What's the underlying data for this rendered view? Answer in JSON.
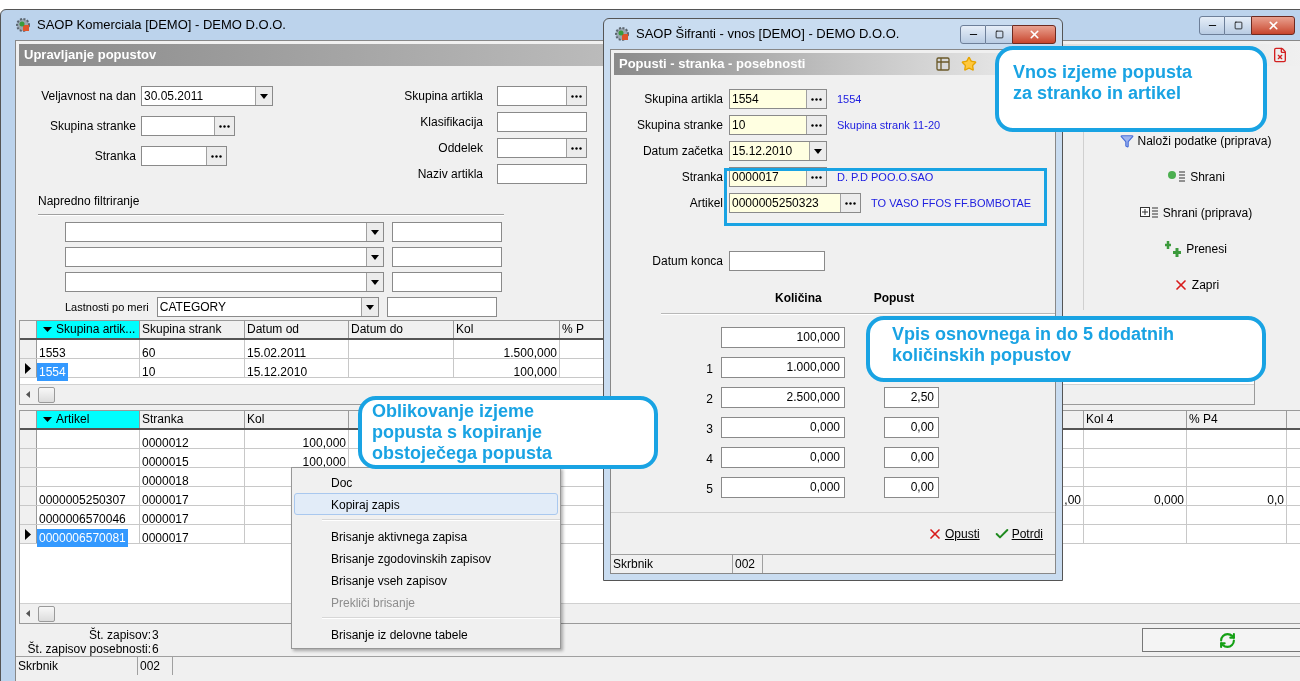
{
  "main_window": {
    "title": "SAOP Komerciala [DEMO] - DEMO D.O.O.",
    "panel_title": "Upravljanje popustov"
  },
  "filters": {
    "left": [
      {
        "label": "Veljavnost na dan",
        "kind": "date",
        "value": "30.05.2011"
      },
      {
        "label": "Skupina stranke",
        "kind": "lookup"
      },
      {
        "label": "Stranka",
        "kind": "lookup"
      }
    ],
    "right": [
      {
        "label": "Skupina artikla",
        "kind": "lookup"
      },
      {
        "label": "Klasifikacija",
        "kind": "text"
      },
      {
        "label": "Oddelek",
        "kind": "lookup"
      },
      {
        "label": "Naziv artikla",
        "kind": "text"
      }
    ],
    "advanced_title": "Napredno filtriranje",
    "advanced_rows": [
      {
        "kind": "combo"
      },
      {
        "kind": "combo"
      },
      {
        "kind": "combo"
      },
      {
        "kind": "custom",
        "label": "Lastnosti po meri",
        "value": "CATEGORY"
      }
    ]
  },
  "toolbar": [
    {
      "kind": "load",
      "label": "Naloži podatke (priprava)"
    },
    {
      "kind": "save",
      "label": "Shrani"
    },
    {
      "kind": "draft",
      "label": "Shrani (priprava)"
    },
    {
      "kind": "transfer",
      "label": "Prenesi"
    },
    {
      "kind": "close",
      "label": "Zapri"
    }
  ],
  "upper_table": {
    "columns": [
      {
        "label": "Skupina artik...",
        "sorted": true
      },
      {
        "label": "Skupina strank",
        "sorted": false
      },
      {
        "label": "Datum od",
        "sorted": false
      },
      {
        "label": "Datum do",
        "sorted": false
      },
      {
        "label": "Kol",
        "sorted": false
      },
      {
        "label": "% P",
        "sorted": false
      }
    ],
    "rows": [
      {
        "selected": false,
        "cells": {
          "skupina_artikla": "1553",
          "skupina_strank": "60",
          "datum_od": "15.02.2011",
          "kol": "1.500,000"
        }
      },
      {
        "selected": true,
        "cells": {
          "skupina_artikla": "1554",
          "skupina_strank": "10",
          "datum_od": "15.12.2010",
          "kol": "100,000"
        }
      }
    ]
  },
  "lower_table": {
    "columns": [
      {
        "label": "Artikel",
        "sorted": true
      },
      {
        "label": "Stranka",
        "sorted": false
      },
      {
        "label": "Kol",
        "sorted": false
      },
      {
        "sorted": false
      },
      {
        "label": "Kol 4",
        "sorted": false
      },
      {
        "label": "% P4",
        "sorted": false
      }
    ],
    "rows": [
      {
        "selected": false,
        "cells": {
          "stranka": "0000012",
          "kol": "100,000"
        }
      },
      {
        "selected": false,
        "cells": {
          "stranka": "0000015",
          "kol": "100,000"
        }
      },
      {
        "selected": false,
        "cells": {
          "stranka": "0000018"
        }
      },
      {
        "selected": false,
        "cells": {
          "artikel": "0000005250307",
          "stranka": "0000017",
          "column_4": ",00",
          "kol_4": "0,000",
          "p4": "0,0"
        }
      },
      {
        "selected": false,
        "cells": {
          "artikel": "0000006570046",
          "stranka": "0000017"
        }
      },
      {
        "selected": true,
        "cells": {
          "artikel": "0000006570081",
          "stranka": "0000017"
        }
      }
    ]
  },
  "status": {
    "records_label": "Št. zapisov:",
    "records": "3",
    "special_label": "Št. zapisov posebnosti:",
    "special": "6"
  },
  "status_bar": {
    "label": "Skrbnik",
    "value": "002"
  },
  "context_menu": [
    {
      "kind": "item",
      "label": "Doc",
      "selected": false,
      "disabled": false
    },
    {
      "kind": "item",
      "label": "Kopiraj zapis",
      "selected": true,
      "disabled": false
    },
    {
      "kind": "separator"
    },
    {
      "kind": "item",
      "label": "Brisanje aktivnega zapisa",
      "selected": false,
      "disabled": false
    },
    {
      "kind": "item",
      "label": "Brisanje zgodovinskih zapisov",
      "selected": false,
      "disabled": false
    },
    {
      "kind": "item",
      "label": "Brisanje vseh zapisov",
      "selected": false,
      "disabled": false
    },
    {
      "kind": "item",
      "label": "Prekliči brisanje",
      "selected": false,
      "disabled": true
    },
    {
      "kind": "separator"
    },
    {
      "kind": "item",
      "label": "Brisanje iz delovne tabele",
      "selected": false,
      "disabled": false
    }
  ],
  "dialog": {
    "title": "SAOP Šifranti - vnos [DEMO] - DEMO D.O.O.",
    "panel_title": "Popusti - stranka - posebnosti",
    "fields": [
      {
        "label": "Skupina artikla",
        "kind": "lookup",
        "value": "1554",
        "description": "1554",
        "required": true
      },
      {
        "label": "Skupina stranke",
        "kind": "lookup",
        "value": "10",
        "description": "Skupina strank 11-20",
        "required": true
      },
      {
        "label": "Datum začetka",
        "kind": "date",
        "value": "15.12.2010",
        "required": true
      },
      {
        "label": "Stranka",
        "kind": "lookup",
        "value": "0000017",
        "description": "D. P.D POO.O.SAO",
        "required": true
      },
      {
        "label": "Artikel",
        "kind": "wide",
        "value": "0000005250323",
        "description": "TO VASO FFOS FF.BOMBOTAE",
        "required": true
      }
    ],
    "end_date": {
      "label": "Datum konca",
      "required": false
    },
    "quantity_header": "Količina",
    "discount_header": "Popust",
    "discounts": [
      {
        "quantity": "100,000"
      },
      {
        "index": "1",
        "quantity": "1.000,000"
      },
      {
        "index": "2",
        "quantity": "2.500,000",
        "discount": "2,50"
      },
      {
        "index": "3",
        "quantity": "0,000",
        "discount": "0,00"
      },
      {
        "index": "4",
        "quantity": "0,000",
        "discount": "0,00"
      },
      {
        "index": "5",
        "quantity": "0,000",
        "discount": "0,00"
      }
    ],
    "buttons": [
      {
        "kind": "cancel",
        "label": "Opusti"
      },
      {
        "kind": "confirm",
        "label": "Potrdi"
      }
    ],
    "status_bar": {
      "label": "Skrbnik",
      "value": "002"
    }
  },
  "annotations": [
    {
      "lines": [
        "Vnos izjeme popusta",
        "za stranko in artikel"
      ]
    },
    {
      "lines": [
        "Vpis osnovnega in do 5 dodatnih",
        "količinskih popustov"
      ]
    },
    {
      "lines": [
        "Oblikovanje izjeme",
        "popusta s kopiranje",
        "obstoječega popusta"
      ]
    }
  ]
}
